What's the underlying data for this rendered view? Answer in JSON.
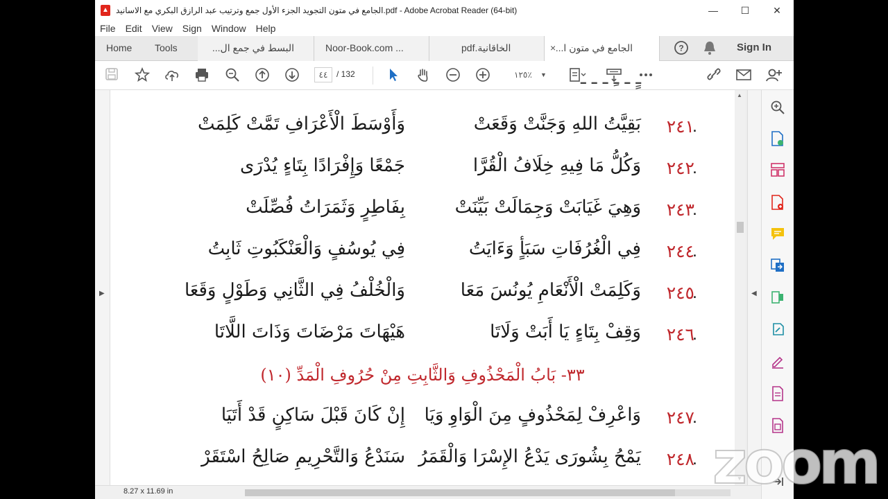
{
  "window": {
    "title": "الجامع في متون التجويد الجزء الأول جمع وترتيب عبد الرازق البكري مع الاسانيد.pdf - Adobe Acrobat Reader (64-bit)",
    "minimize": "—",
    "maximize": "☐",
    "close": "✕"
  },
  "menu": [
    "File",
    "Edit",
    "View",
    "Sign",
    "Window",
    "Help"
  ],
  "tabs": {
    "home": "Home",
    "tools": "Tools",
    "doc1": "البسط في جمع ال...",
    "doc2": "Noor-Book.com ...",
    "doc3": "pdf.الخاقانية",
    "doc4": "الجامع في متون ا...",
    "close_symbol": "×",
    "sign_in": "Sign In"
  },
  "toolbar": {
    "page_current": "٤٤",
    "page_total": "/  132",
    "zoom_value": "١٢٥٪"
  },
  "document": {
    "verses": [
      {
        "num": "٢٤١",
        "first": "بَقِيَّتُ اللهِ وَجَنَّتْ وَقَعَتْ",
        "second": "وَأَوْسَطَ الْأَعْرَافِ تَمَّتْ كَلِمَتْ"
      },
      {
        "num": "٢٤٢",
        "first": "وَكُلُّ مَا فِيهِ خِلَافُ الْقُرَّا",
        "second": "جَمْعًا وَإِفْرَادًا بِتَاءٍ يُدْرَى"
      },
      {
        "num": "٢٤٣",
        "first": "وَهِيَ غَيَابَتْ وَجِمَالَتْ بَيِّنَتْ",
        "second": "بِفَاطِرٍ وَثَمَرَاتُ فُصِّلَتْ"
      },
      {
        "num": "٢٤٤",
        "first": "فِي الْغُرُفَاتِ سَبَأٍ وَءَايَتُ",
        "second": "فِي يُوسُفٍ وَالْعَنْكَبُوتِ ثَابِتُ"
      },
      {
        "num": "٢٤٥",
        "first": "وَكَلِمَتْ الْأَنْعَامِ يُونُسَ مَعَا",
        "second": "وَالْخُلْفُ فِي الثَّانِي وَطَوْلٍ وَقَعَا"
      },
      {
        "num": "٢٤٦",
        "first": "وَقِفْ بِتَاءٍ يَا أَبَتْ وَلَاتَا",
        "second": "هَيْهَاتَ مَرْضَاتَ وَذَاتَ اللَّاتَا"
      },
      {
        "num": "٢٤٧",
        "first": "وَاعْرِفْ لِمَحْذُوفٍ مِنَ الْوَاوِ وَيَا",
        "second": "إِنْ كَانَ قَبْلَ سَاكِنٍ قَدْ أَتَيَا"
      },
      {
        "num": "٢٤٨",
        "first": "يَمْحُ بِشُورَى يَدْعُ الإِسْرَا وَالْقَمَرُ",
        "second": "سَنَدْعُ وَالتَّحْرِيمِ صَالِحُ اسْتَقَرْ"
      }
    ],
    "chapter_heading": "٣٣- بَابُ الْمَحْذُوفِ وَالثَّابِتِ مِنْ حُرُوفِ الْمَدِّ (١٠)"
  },
  "status": {
    "page_size": "8.27 x 11.69 in"
  },
  "watermark": "zoom",
  "colors": {
    "accent_red": "#c0282d",
    "acrobat_red": "#e1261c"
  }
}
